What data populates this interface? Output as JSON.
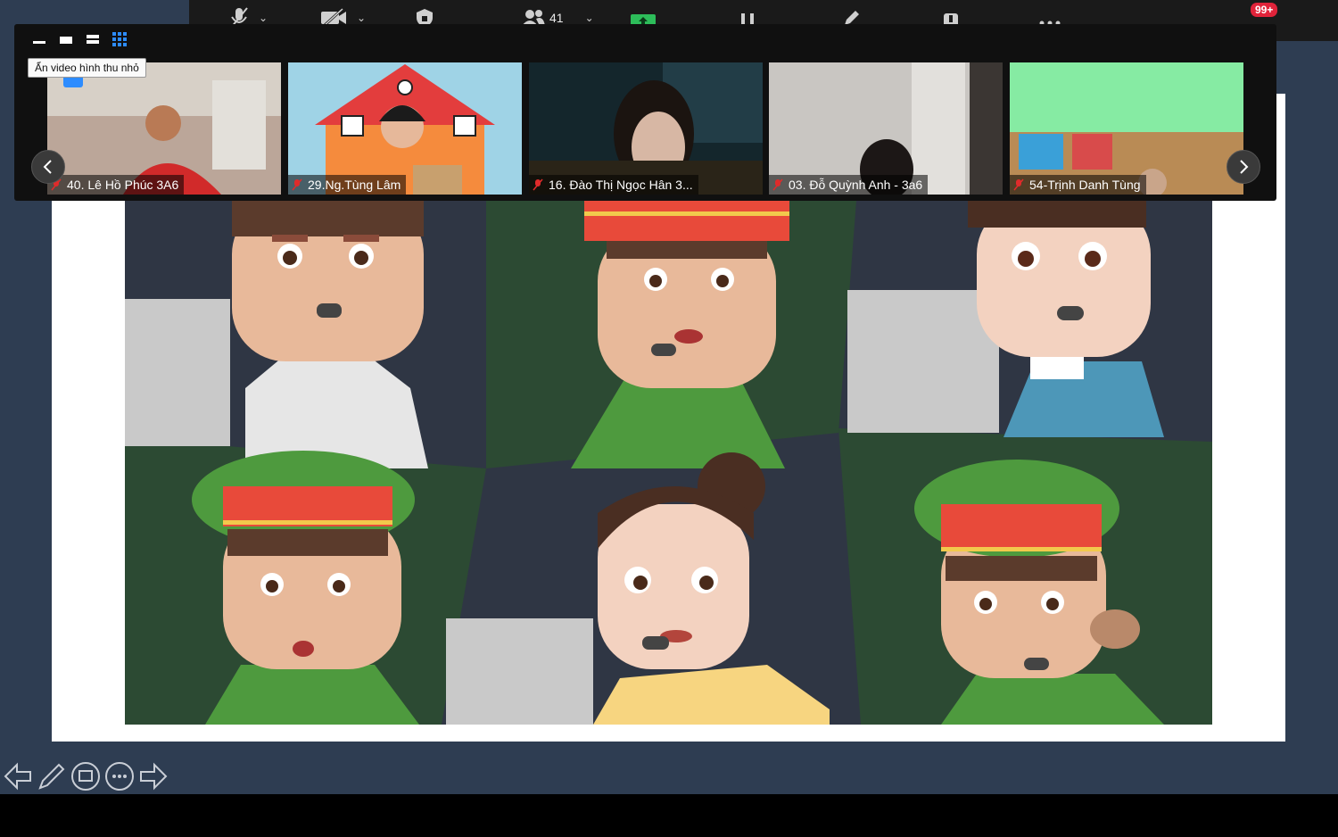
{
  "toolbar": {
    "participants_count": "41",
    "notifications_badge": "99+"
  },
  "thumbnail_strip": {
    "tooltip": "Ẩn video hình thu nhỏ",
    "participants": [
      {
        "name": "40. Lê Hồ Phúc 3A6"
      },
      {
        "name": "29.Ng.Tùng Lâm"
      },
      {
        "name": "16. Đào Thị  Ngọc Hân 3..."
      },
      {
        "name": "03. Đỗ Quỳnh Anh - 3a6"
      },
      {
        "name": "54-Trịnh Danh Tùng"
      }
    ]
  },
  "colors": {
    "panel_dark_green": "#2c4a33",
    "panel_navy": "#2f3644",
    "uniform_green": "#4e9a3e",
    "cap_red": "#e84a3a",
    "skin": "#e8b99a",
    "accent_green": "#2dbd5a",
    "badge_red": "#e0233a"
  },
  "icons": [
    "mute-mic-icon",
    "stop-video-icon",
    "security-icon",
    "participants-icon",
    "share-screen-icon",
    "pause-icon",
    "annotate-icon",
    "record-icon",
    "more-icon",
    "mic-off-icon",
    "prev-icon",
    "next-icon",
    "pen-icon",
    "slides-icon",
    "options-icon"
  ]
}
